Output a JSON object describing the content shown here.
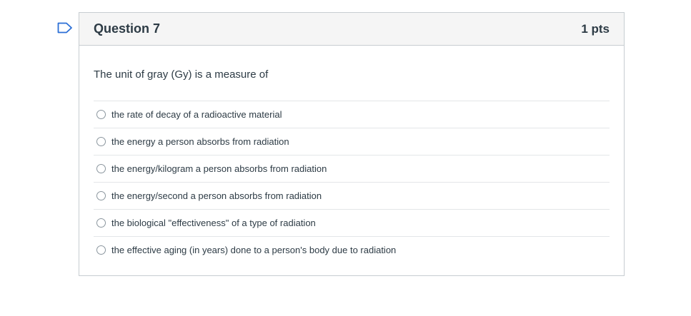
{
  "question": {
    "title": "Question 7",
    "points": "1 pts",
    "text": "The unit of gray (Gy) is a measure of",
    "answers": [
      {
        "label": "the rate of decay of a radioactive material"
      },
      {
        "label": "the energy a person absorbs from radiation"
      },
      {
        "label": "the energy/kilogram a person absorbs from radiation"
      },
      {
        "label": "the energy/second a person absorbs from radiation"
      },
      {
        "label": "the biological \"effectiveness\" of a type of radiation"
      },
      {
        "label": "the effective aging (in years) done to a person's body due to radiation"
      }
    ]
  },
  "colors": {
    "flag": "#2b6fd6",
    "header_bg": "#f5f5f5",
    "border": "#c7cdd1",
    "text": "#2d3b45"
  },
  "icons": {
    "flag": "bookmark-flag-icon",
    "answer_marker": "radio-button"
  }
}
